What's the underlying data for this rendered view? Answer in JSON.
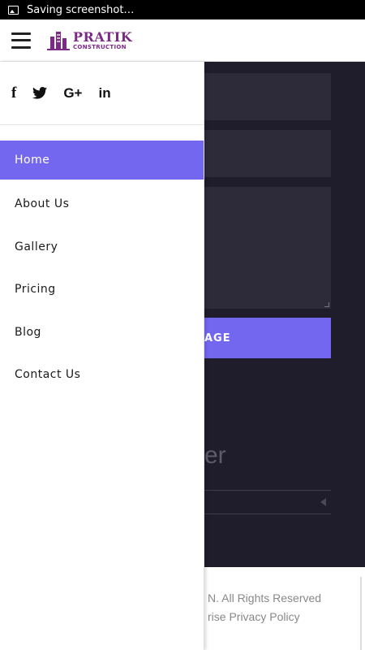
{
  "status_bar": {
    "text": "Saving screenshot…"
  },
  "header": {
    "logo_title": "PRATIK",
    "logo_subtitle": "CONSTRUCTION",
    "brand_color": "#7b2a86"
  },
  "drawer": {
    "social": [
      {
        "icon": "facebook-icon",
        "glyph": "f"
      },
      {
        "icon": "twitter-icon",
        "glyph": ""
      },
      {
        "icon": "google-plus-icon",
        "glyph": "G+"
      },
      {
        "icon": "linkedin-icon",
        "glyph": "in"
      }
    ],
    "menu": [
      {
        "label": "Home",
        "active": true
      },
      {
        "label": "About Us"
      },
      {
        "label": "Gallery"
      },
      {
        "label": "Pricing"
      },
      {
        "label": "Blog"
      },
      {
        "label": "Contact Us"
      }
    ],
    "accent": "#7367f0"
  },
  "background": {
    "button_label": "AGE",
    "heading_fragment": "er",
    "footer_line1": "N. All Rights Reserved",
    "footer_line2": "rise Privacy Policy"
  }
}
